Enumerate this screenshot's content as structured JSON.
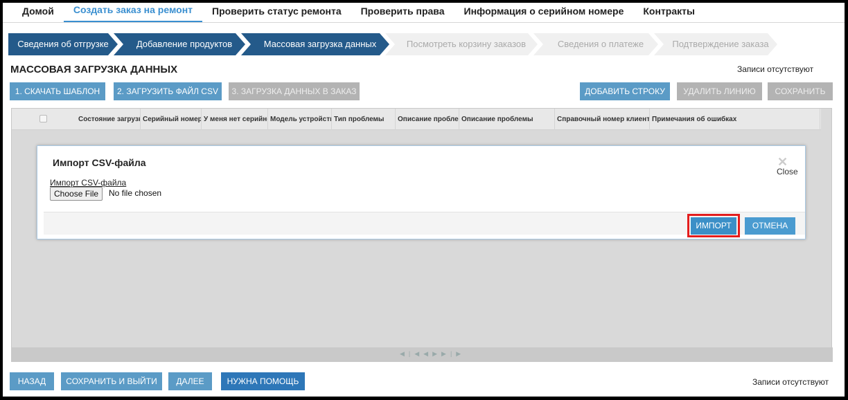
{
  "topnav": {
    "items": [
      {
        "label": "Домой"
      },
      {
        "label": "Создать заказ на ремонт"
      },
      {
        "label": "Проверить статус ремонта"
      },
      {
        "label": "Проверить права"
      },
      {
        "label": "Информация о серийном номере"
      },
      {
        "label": "Контракты"
      }
    ]
  },
  "steps": [
    {
      "label": "Сведения об отгрузке",
      "state": "done"
    },
    {
      "label": "Добавление продуктов",
      "state": "done"
    },
    {
      "label": "Массовая загрузка данных",
      "state": "current"
    },
    {
      "label": "Посмотреть корзину заказов",
      "state": "pending"
    },
    {
      "label": "Сведения о платеже",
      "state": "pending"
    },
    {
      "label": "Подтверждение заказа",
      "state": "pending"
    }
  ],
  "page": {
    "title": "МАССОВАЯ ЗАГРУЗКА ДАННЫХ",
    "records_status": "Записи отсутствуют"
  },
  "toolbar": {
    "download_template": "1. СКАЧАТЬ ШАБЛОН",
    "upload_csv": "2. ЗАГРУЗИТЬ ФАЙЛ CSV",
    "load_into_order": "3. ЗАГРУЗКА ДАННЫХ В ЗАКАЗ",
    "add_row": "ДОБАВИТЬ СТРОКУ",
    "delete_line": "УДАЛИТЬ ЛИНИЮ",
    "save": "СОХРАНИТЬ"
  },
  "grid": {
    "columns": [
      "Состояние загрузки",
      "Серийный номер",
      "У меня нет серийного номера",
      "Модель устройства",
      "Тип проблемы",
      "Описание проблемы",
      "Описание проблемы",
      "Справочный номер клиента",
      "Примечания об ошибках"
    ],
    "pager_icons": [
      "first-page-icon",
      "prev-page-icon",
      "next-page-icon",
      "last-page-icon"
    ]
  },
  "modal": {
    "title": "Импорт CSV-файла",
    "close_label": "Close",
    "field_label": "Импорт CSV-файла",
    "choose_file": "Choose File",
    "no_file": "No file chosen",
    "import_button": "ИМПОРТ",
    "cancel_button": "ОТМЕНА"
  },
  "footer": {
    "back": "НАЗАД",
    "save_exit": "СОХРАНИТЬ И ВЫЙТИ",
    "next": "ДАЛЕЕ",
    "help": "НУЖНА ПОМОЩЬ",
    "records_status": "Записи отсутствуют"
  },
  "colors": {
    "accent": "#3a8fd0",
    "step_done": "#245a8a",
    "button": "#5b9bc6",
    "highlight": "#e31d1d"
  }
}
